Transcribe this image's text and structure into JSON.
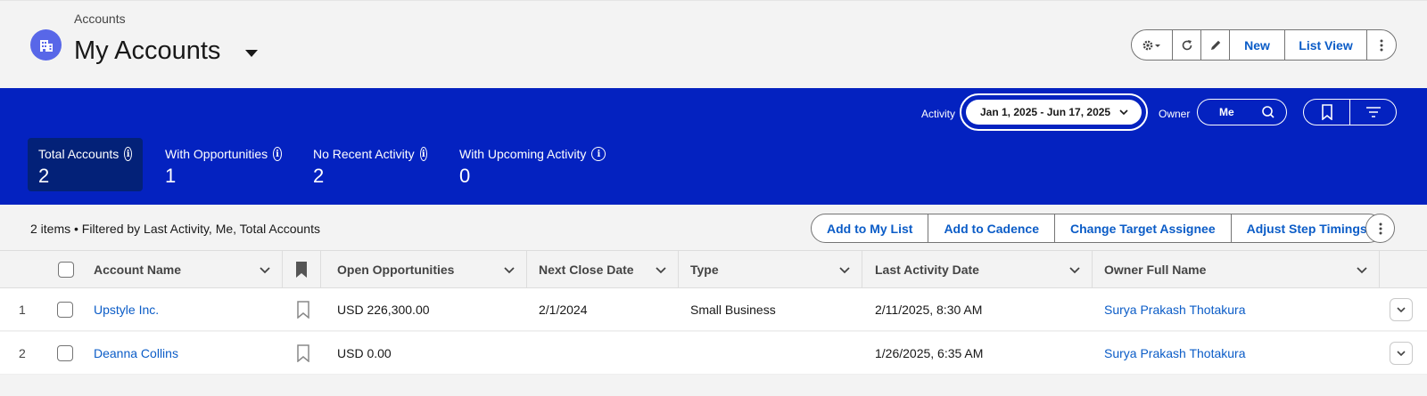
{
  "header": {
    "breadcrumb": "Accounts",
    "title": "My Accounts",
    "buttons": {
      "new": "New",
      "list_view": "List View"
    }
  },
  "filters": {
    "activity_label": "Activity",
    "activity_value": "Jan 1, 2025 - Jun 17, 2025",
    "owner_label": "Owner",
    "owner_value": "Me"
  },
  "metrics": [
    {
      "label": "Total Accounts",
      "value": "2"
    },
    {
      "label": "With Opportunities",
      "value": "1"
    },
    {
      "label": "No Recent Activity",
      "value": "2"
    },
    {
      "label": "With Upcoming Activity",
      "value": "0"
    }
  ],
  "toolbar": {
    "items_info": "2 items • Filtered by Last Activity, Me, Total Accounts",
    "actions": [
      "Add to My List",
      "Add to Cadence",
      "Change Target Assignee",
      "Adjust Step Timings"
    ]
  },
  "table": {
    "columns": [
      "Account Name",
      "Open Opportunities",
      "Next Close Date",
      "Type",
      "Last Activity Date",
      "Owner Full Name"
    ],
    "rows": [
      {
        "num": "1",
        "account": "Upstyle Inc.",
        "open_opps": "USD 226,300.00",
        "next_close": "2/1/2024",
        "type": "Small Business",
        "last_activity": "2/11/2025, 8:30 AM",
        "owner": "Surya Prakash Thotakura"
      },
      {
        "num": "2",
        "account": "Deanna Collins",
        "open_opps": "USD 0.00",
        "next_close": "",
        "type": "",
        "last_activity": "1/26/2025, 6:35 AM",
        "owner": "Surya Prakash Thotakura"
      }
    ]
  },
  "colors": {
    "band": "#0422c0",
    "active_metric": "#032178",
    "link": "#0b5cc7",
    "object_icon": "#5867e8"
  }
}
